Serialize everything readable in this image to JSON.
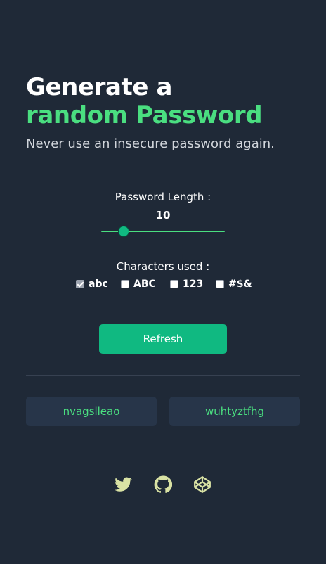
{
  "header": {
    "title_line1": "Generate a",
    "title_line2": "random Password",
    "subtitle": "Never use an insecure password again."
  },
  "length": {
    "label": "Password Length :",
    "value": "10",
    "slider_fraction": 0.15
  },
  "characters": {
    "label": "Characters used :",
    "options": [
      {
        "label": "abc",
        "checked": true
      },
      {
        "label": "ABC",
        "checked": false
      },
      {
        "label": "123",
        "checked": false
      },
      {
        "label": "#$&",
        "checked": false
      }
    ]
  },
  "refresh_label": "Refresh",
  "passwords": [
    "nvagslleao",
    "wuhtyztfhg"
  ],
  "social_icons": [
    "twitter-icon",
    "github-icon",
    "codepen-icon"
  ],
  "colors": {
    "background": "#1f2937",
    "accent": "#4ade80",
    "button": "#10b981",
    "card": "#273549",
    "icon": "#d9e2a4"
  }
}
